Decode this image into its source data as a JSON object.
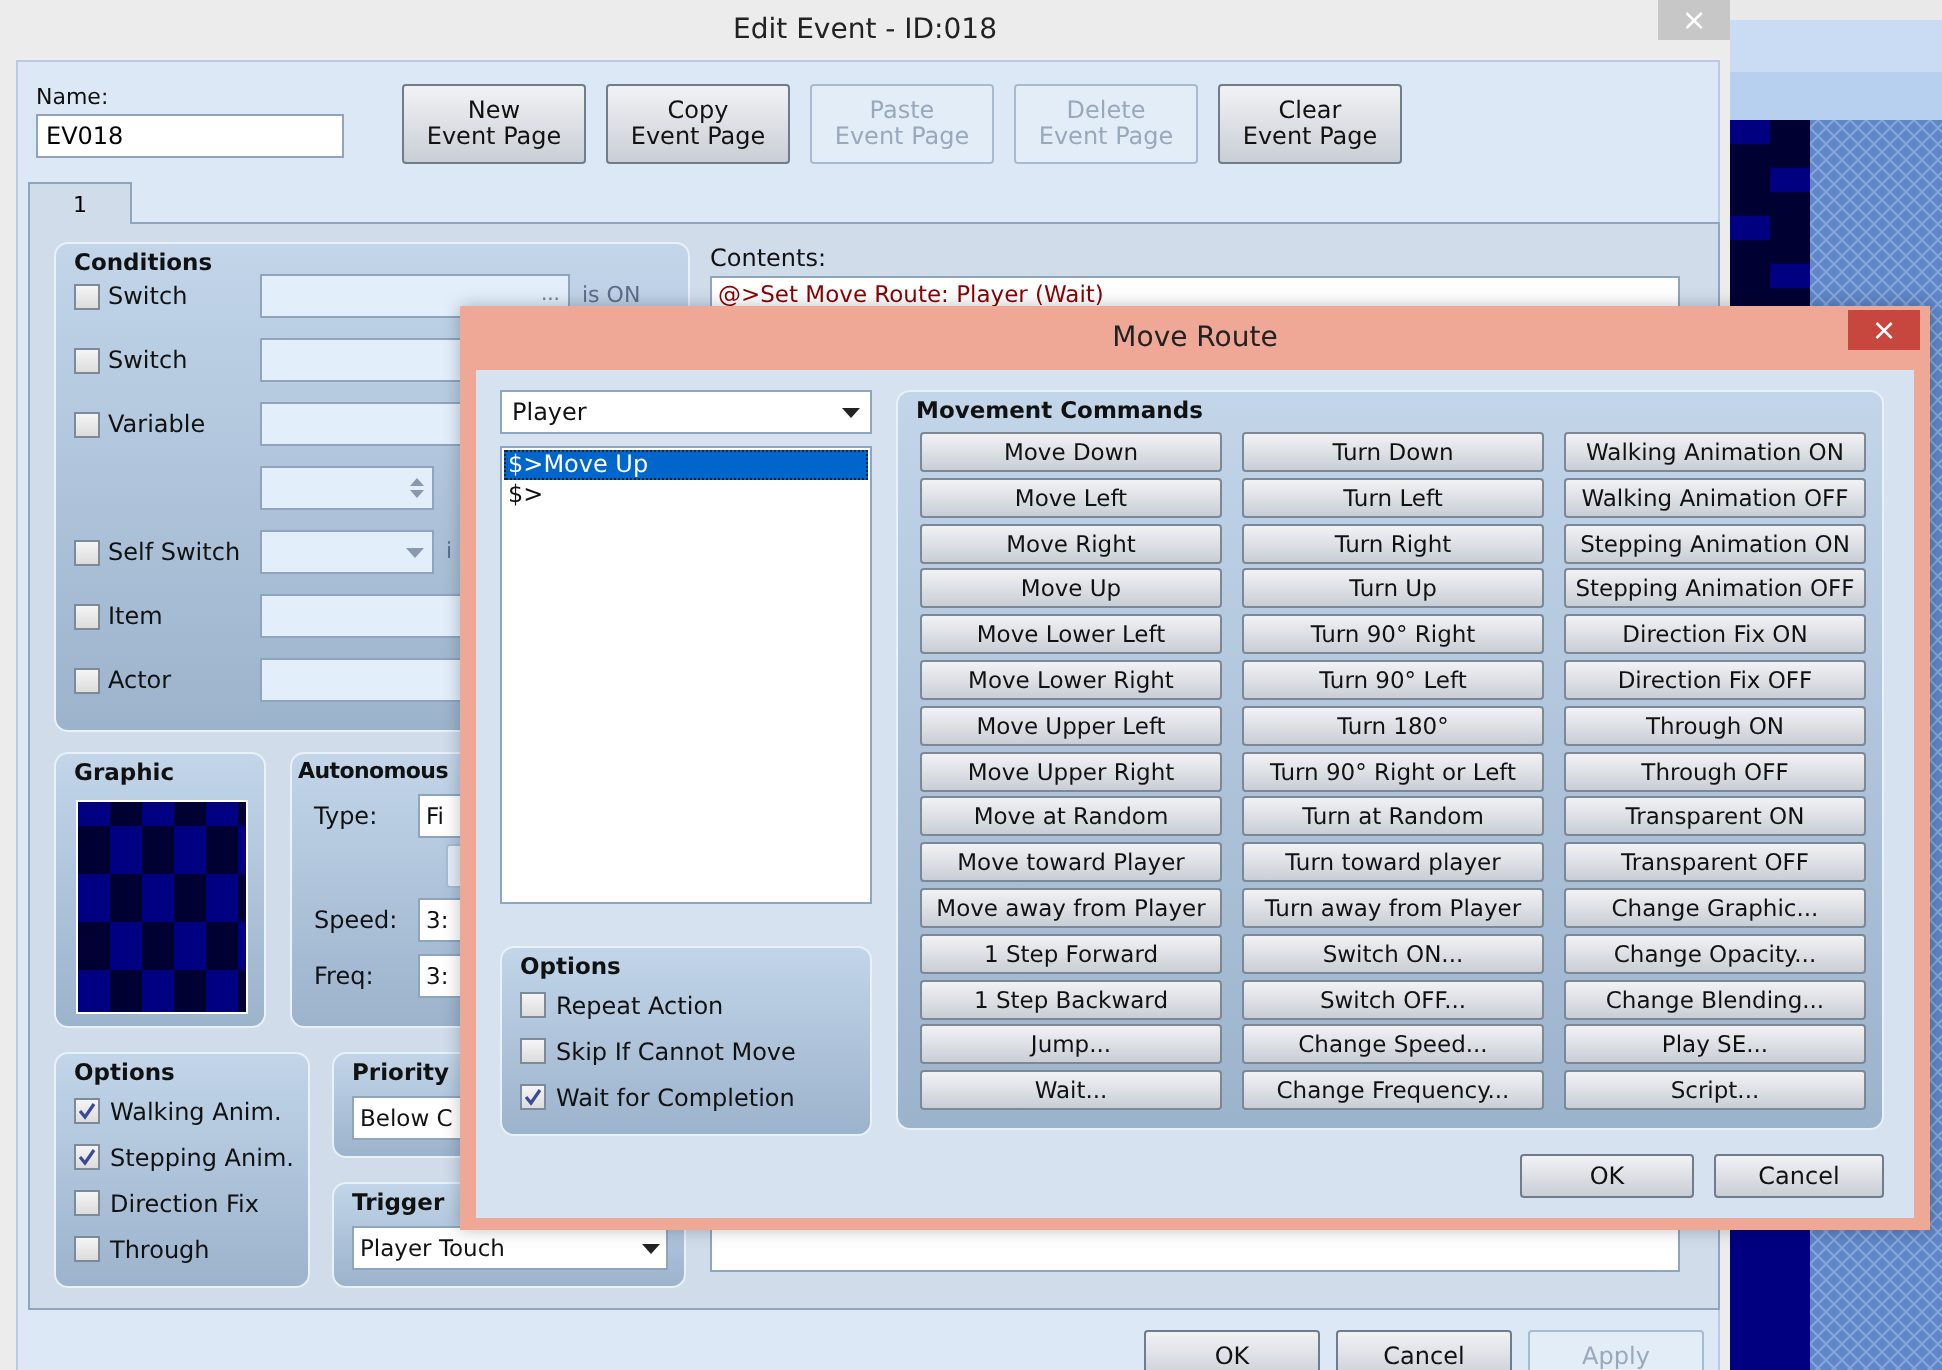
{
  "edit_event": {
    "title": "Edit Event - ID:018",
    "close": "×",
    "name_label": "Name:",
    "name_value": "EV018",
    "page_buttons": [
      {
        "label": "New\nEvent Page",
        "disabled": false
      },
      {
        "label": "Copy\nEvent Page",
        "disabled": false
      },
      {
        "label": "Paste\nEvent Page",
        "disabled": true
      },
      {
        "label": "Delete\nEvent Page",
        "disabled": true
      },
      {
        "label": "Clear\nEvent Page",
        "disabled": false
      }
    ],
    "tabs": [
      {
        "label": "1",
        "selected": true
      }
    ],
    "conditions": {
      "title": "Conditions",
      "rows": [
        {
          "kind": "select",
          "label": "Switch",
          "checked": false,
          "browse": "...",
          "suffix": "is ON"
        },
        {
          "kind": "select",
          "label": "Switch",
          "checked": false
        },
        {
          "kind": "select",
          "label": "Variable",
          "checked": false
        },
        {
          "kind": "spin"
        },
        {
          "kind": "dropdown",
          "label": "Self Switch",
          "checked": false,
          "suffix": "i"
        },
        {
          "kind": "select",
          "label": "Item",
          "checked": false
        },
        {
          "kind": "select",
          "label": "Actor",
          "checked": false
        }
      ]
    },
    "contents": {
      "label": "Contents:",
      "lines": [
        "@>Set Move Route: Player (Wait)"
      ]
    },
    "graphic": {
      "title": "Graphic"
    },
    "autonomous": {
      "title": "Autonomous",
      "type_label": "Type:",
      "type_value": "Fi",
      "speed_label": "Speed:",
      "speed_value": "3:",
      "freq_label": "Freq:",
      "freq_value": "3:"
    },
    "options": {
      "title": "Options",
      "items": [
        {
          "label": "Walking Anim.",
          "checked": true
        },
        {
          "label": "Stepping Anim.",
          "checked": true
        },
        {
          "label": "Direction Fix",
          "checked": false
        },
        {
          "label": "Through",
          "checked": false
        }
      ]
    },
    "priority": {
      "title": "Priority",
      "value": "Below C"
    },
    "trigger": {
      "title": "Trigger",
      "value": "Player Touch"
    },
    "buttons": [
      {
        "label": "OK",
        "disabled": false
      },
      {
        "label": "Cancel",
        "disabled": false
      },
      {
        "label": "Apply",
        "disabled": true
      }
    ]
  },
  "move_route": {
    "title": "Move Route",
    "close": "×",
    "target": "Player",
    "steps": [
      {
        "text": "$>Move Up",
        "selected": true
      },
      {
        "text": "$>",
        "selected": false
      }
    ],
    "options": {
      "title": "Options",
      "items": [
        {
          "label": "Repeat Action",
          "checked": false
        },
        {
          "label": "Skip If Cannot Move",
          "checked": false
        },
        {
          "label": "Wait for Completion",
          "checked": true
        }
      ]
    },
    "commands_title": "Movement Commands",
    "commands": [
      "Move Down",
      "Turn Down",
      "Walking Animation ON",
      "Move Left",
      "Turn Left",
      "Walking Animation OFF",
      "Move Right",
      "Turn Right",
      "Stepping Animation ON",
      "Move Up",
      "Turn Up",
      "Stepping Animation OFF",
      "Move Lower Left",
      "Turn 90° Right",
      "Direction Fix ON",
      "Move Lower Right",
      "Turn 90° Left",
      "Direction Fix OFF",
      "Move Upper Left",
      "Turn 180°",
      "Through ON",
      "Move Upper Right",
      "Turn 90° Right or Left",
      "Through OFF",
      "Move at Random",
      "Turn at Random",
      "Transparent ON",
      "Move toward Player",
      "Turn toward player",
      "Transparent OFF",
      "Move away from Player",
      "Turn away from Player",
      "Change Graphic...",
      "1 Step Forward",
      "Switch ON...",
      "Change Opacity...",
      "1 Step Backward",
      "Switch OFF...",
      "Change Blending...",
      "Jump...",
      "Change Speed...",
      "Play SE...",
      "Wait...",
      "Change Frequency...",
      "Script..."
    ],
    "buttons": [
      {
        "label": "OK",
        "disabled": false
      },
      {
        "label": "Cancel",
        "disabled": false
      }
    ]
  }
}
